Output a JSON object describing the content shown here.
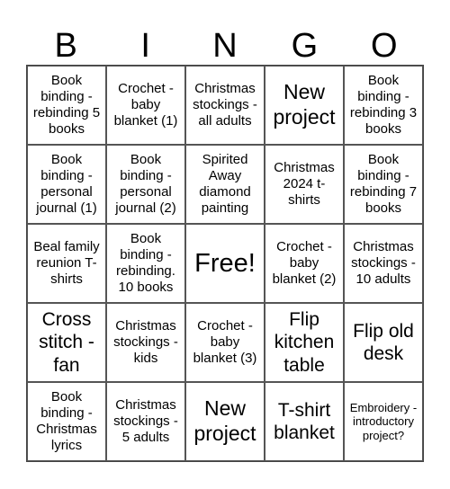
{
  "header": [
    "B",
    "I",
    "N",
    "G",
    "O"
  ],
  "cells": [
    {
      "text": "Book binding - rebinding 5 books",
      "size": "md"
    },
    {
      "text": "Crochet - baby blanket (1)",
      "size": "md"
    },
    {
      "text": "Christmas stockings - all adults",
      "size": "md"
    },
    {
      "text": "New project",
      "size": "xl"
    },
    {
      "text": "Book binding - rebinding 3 books",
      "size": "md"
    },
    {
      "text": "Book binding - personal journal (1)",
      "size": "md"
    },
    {
      "text": "Book binding - personal journal (2)",
      "size": "md"
    },
    {
      "text": "Spirited Away diamond painting",
      "size": "md"
    },
    {
      "text": "Christmas 2024 t-shirts",
      "size": "md"
    },
    {
      "text": "Book binding - rebinding 7 books",
      "size": "md"
    },
    {
      "text": "Beal family reunion T-shirts",
      "size": "md"
    },
    {
      "text": "Book binding - rebinding. 10 books",
      "size": "md"
    },
    {
      "text": "Free!",
      "size": "xxl"
    },
    {
      "text": "Crochet - baby blanket (2)",
      "size": "md"
    },
    {
      "text": "Christmas stockings - 10 adults",
      "size": "md"
    },
    {
      "text": "Cross stitch - fan",
      "size": "lg"
    },
    {
      "text": "Christmas stockings - kids",
      "size": "md"
    },
    {
      "text": "Crochet - baby blanket (3)",
      "size": "md"
    },
    {
      "text": "Flip kitchen table",
      "size": "lg"
    },
    {
      "text": "Flip old desk",
      "size": "lg"
    },
    {
      "text": "Book binding - Christmas lyrics",
      "size": "md"
    },
    {
      "text": "Christmas stockings - 5 adults",
      "size": "md"
    },
    {
      "text": "New project",
      "size": "xl"
    },
    {
      "text": "T-shirt blanket",
      "size": "lg"
    },
    {
      "text": "Embroidery - introductory project?",
      "size": "sm"
    }
  ]
}
